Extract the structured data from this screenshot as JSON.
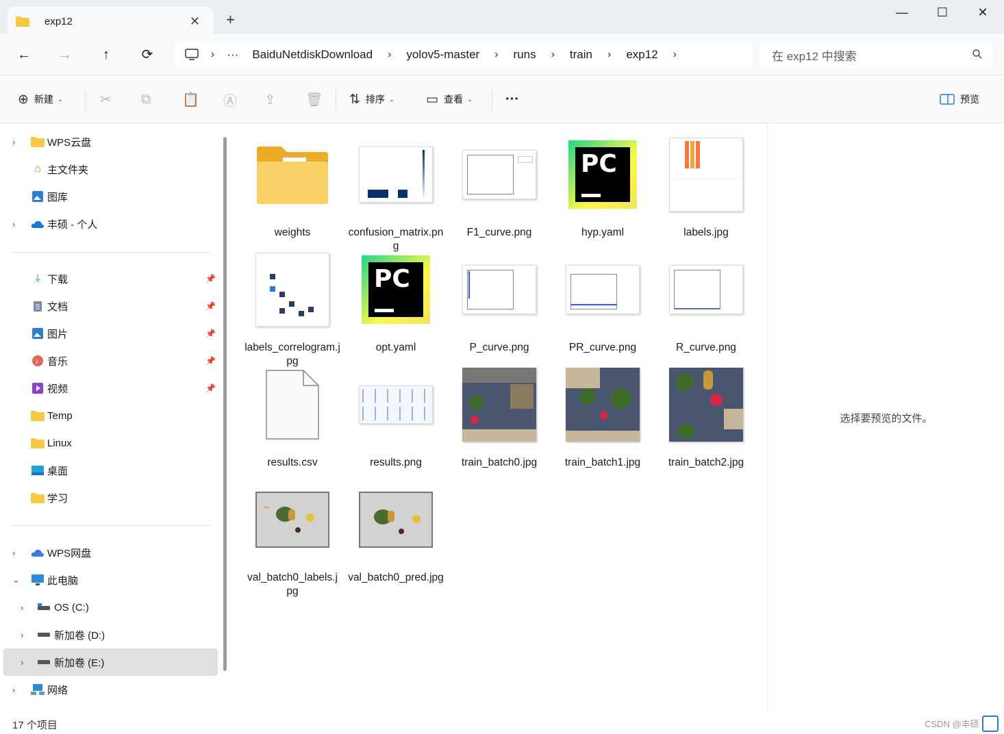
{
  "window": {
    "tab_title": "exp12",
    "new_tab": "+",
    "min": "—",
    "max": "☐",
    "close": "✕",
    "tab_close": "✕"
  },
  "nav": {
    "back": "←",
    "forward": "→",
    "up": "↑",
    "refresh": "⟳"
  },
  "breadcrumb": {
    "more": "···",
    "items": [
      "BaiduNetdiskDownload",
      "yolov5-master",
      "runs",
      "train",
      "exp12"
    ]
  },
  "search": {
    "placeholder": "在 exp12 中搜索"
  },
  "toolbar": {
    "new": "新建",
    "sort": "排序",
    "view": "查看",
    "more": "···",
    "preview": "预览"
  },
  "sidebar": {
    "quick": [
      {
        "label": "WPS云盘",
        "icon": "folder"
      },
      {
        "label": "主文件夹",
        "icon": "home"
      },
      {
        "label": "图库",
        "icon": "gallery"
      },
      {
        "label": "丰硕 - 个人",
        "icon": "onedrive"
      }
    ],
    "pinned": [
      {
        "label": "下载",
        "icon": "download"
      },
      {
        "label": "文档",
        "icon": "document"
      },
      {
        "label": "图片",
        "icon": "pictures"
      },
      {
        "label": "音乐",
        "icon": "music"
      },
      {
        "label": "视频",
        "icon": "video"
      },
      {
        "label": "Temp",
        "icon": "folder"
      },
      {
        "label": "Linux",
        "icon": "folder"
      },
      {
        "label": "桌面",
        "icon": "desktop"
      },
      {
        "label": "学习",
        "icon": "folder"
      }
    ],
    "bottom": [
      {
        "label": "WPS网盘",
        "icon": "cloud"
      },
      {
        "label": "此电脑",
        "icon": "computer"
      },
      {
        "label": "OS (C:)",
        "icon": "drive"
      },
      {
        "label": "新加卷 (D:)",
        "icon": "drive"
      },
      {
        "label": "新加卷 (E:)",
        "icon": "drive"
      },
      {
        "label": "网络",
        "icon": "network"
      }
    ]
  },
  "files": [
    "weights",
    "confusion_matrix.png",
    "F1_curve.png",
    "hyp.yaml",
    "labels.jpg",
    "labels_correlogram.jpg",
    "opt.yaml",
    "P_curve.png",
    "PR_curve.png",
    "R_curve.png",
    "results.csv",
    "results.png",
    "train_batch0.jpg",
    "train_batch1.jpg",
    "train_batch2.jpg",
    "val_batch0_labels.jpg",
    "val_batch0_pred.jpg"
  ],
  "preview_message": "选择要预览的文件。",
  "status": {
    "count": "17 个项目",
    "watermark": "CSDN @丰硕"
  },
  "colors": {
    "folder": "#f8c844",
    "accent": "#2a7bd4",
    "selected": "#e0e0e0"
  }
}
